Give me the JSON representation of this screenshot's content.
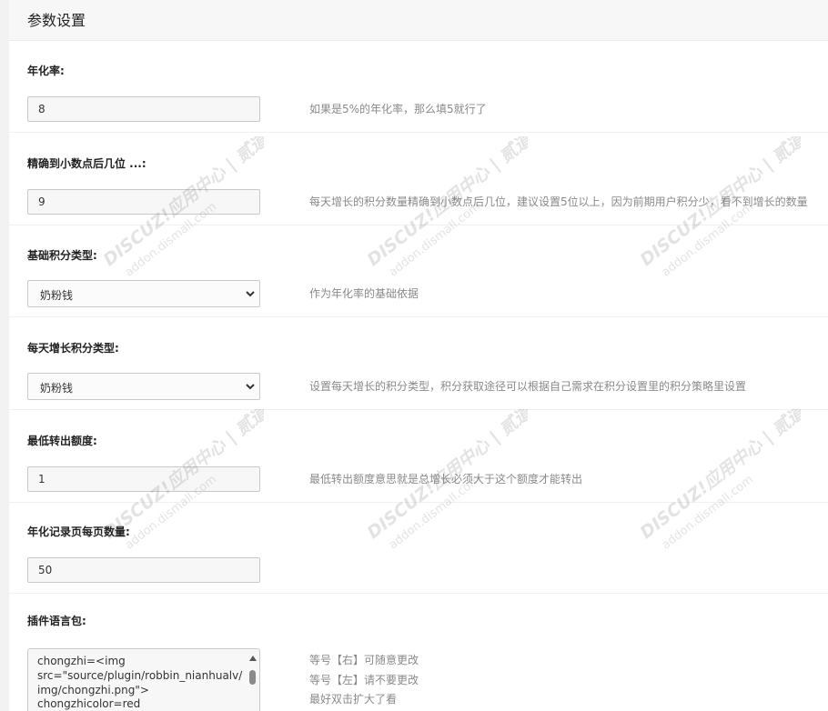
{
  "page_title": "参数设置",
  "settings": [
    {
      "label": "年化率:",
      "value": "8",
      "description": "如果是5%的年化率，那么填5就行了"
    },
    {
      "label": "精确到小数点后几位 ...:",
      "value": "9",
      "description": "每天增长的积分数量精确到小数点后几位，建议设置5位以上，因为前期用户积分少，看不到增长的数量"
    },
    {
      "label": "基础积分类型:",
      "value": "奶粉钱",
      "description": "作为年化率的基础依据"
    },
    {
      "label": "每天增长积分类型:",
      "value": "奶粉钱",
      "description": "设置每天增长的积分类型，积分获取途径可以根据自己需求在积分设置里的积分策略里设置"
    },
    {
      "label": "最低转出额度:",
      "value": "1",
      "description": "最低转出额度意思就是总增长必须大于这个额度才能转出"
    },
    {
      "label": "年化记录页每页数量:",
      "value": "50",
      "description": ""
    }
  ],
  "language_pack": {
    "label": "插件语言包:",
    "lines": [
      "chongzhi=<img",
      "src=\"source/plugin/robbin_nianhualv/",
      "img/chongzhi.png\">",
      "chongzhicolor=red"
    ],
    "notes": [
      "等号【右】可随意更改",
      "等号【左】请不要更改",
      "最好双击扩大了看"
    ]
  },
  "watermark": {
    "brand": "DISCUZ!应用中心 | 贰道",
    "domain": "addon.dismall.com"
  },
  "colors": {
    "panel": "#ffffff",
    "header": "#f7f7f7",
    "description": "#8a8a8a",
    "border": "#c9c9c9"
  }
}
